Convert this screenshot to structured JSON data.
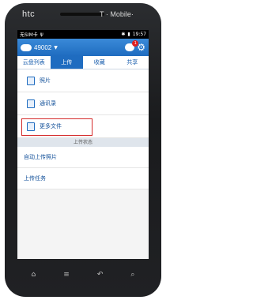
{
  "device": {
    "brand_left": "htc",
    "brand_right": "T · Mobile·"
  },
  "status_bar": {
    "carrier": "无SIM卡",
    "time": "19:57"
  },
  "app_bar": {
    "count": "49002",
    "badge": "1"
  },
  "tabs": [
    {
      "label": "云盘列表",
      "active": false
    },
    {
      "label": "上传",
      "active": true
    },
    {
      "label": "收藏",
      "active": false
    },
    {
      "label": "共享",
      "active": false
    }
  ],
  "upload_items": [
    {
      "label": "照片",
      "icon": "photo-icon"
    },
    {
      "label": "通讯录",
      "icon": "contacts-icon"
    },
    {
      "label": "更多文件",
      "icon": "file-icon"
    }
  ],
  "section_header": "上传状态",
  "status_items": [
    {
      "label": "自动上传照片"
    },
    {
      "label": "上传任务"
    }
  ],
  "colors": {
    "accent": "#1f6cc0",
    "highlight": "#d42a2a"
  }
}
